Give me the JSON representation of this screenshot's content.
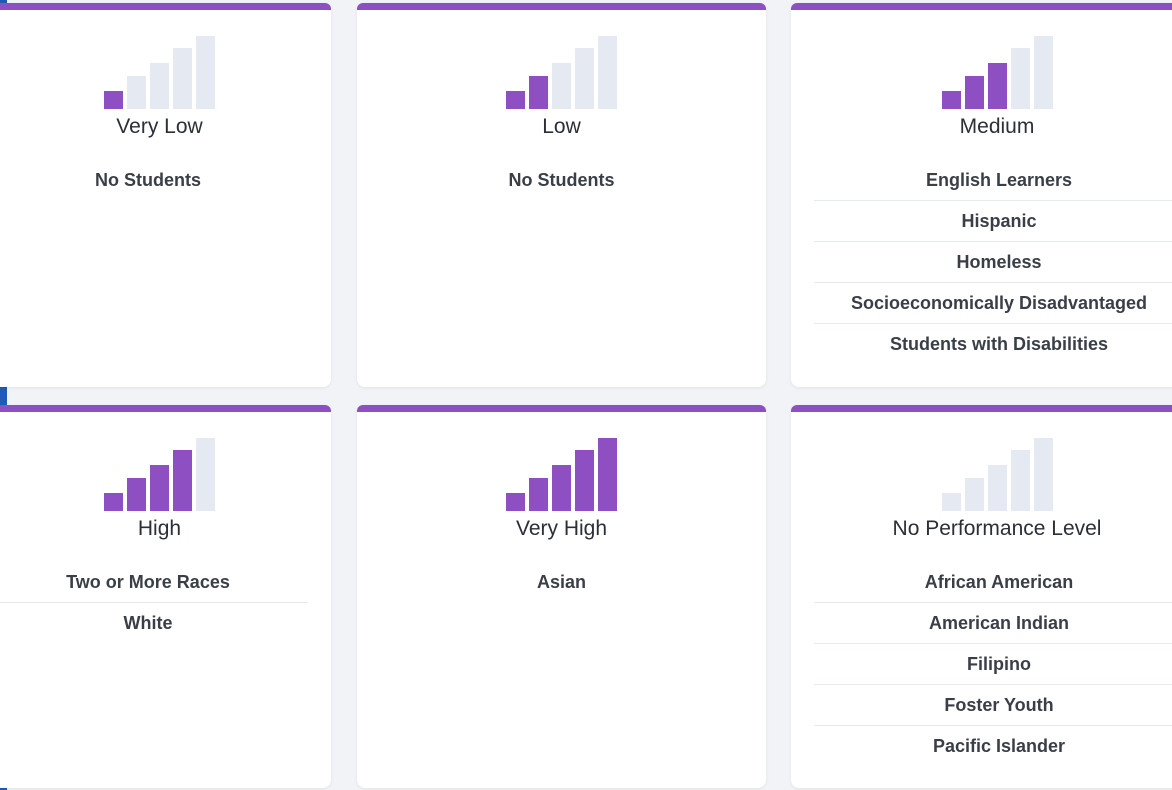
{
  "colors": {
    "accent": "#8e4fc2",
    "inactive_bar": "#e5e9f1",
    "left_stripe": "#1f5bb8"
  },
  "cards": [
    {
      "label": "Very Low",
      "bars_filled": 1,
      "groups": [
        "No Students"
      ]
    },
    {
      "label": "Low",
      "bars_filled": 2,
      "groups": [
        "No Students"
      ]
    },
    {
      "label": "Medium",
      "bars_filled": 3,
      "groups": [
        "English Learners",
        "Hispanic",
        "Homeless",
        "Socioeconomically Disadvantaged",
        "Students with Disabilities"
      ]
    },
    {
      "label": "High",
      "bars_filled": 4,
      "groups": [
        "Two or More Races",
        "White"
      ]
    },
    {
      "label": "Very High",
      "bars_filled": 5,
      "groups": [
        "Asian"
      ]
    },
    {
      "label": "No Performance Level",
      "bars_filled": 0,
      "groups": [
        "African American",
        "American Indian",
        "Filipino",
        "Foster Youth",
        "Pacific Islander"
      ]
    }
  ]
}
